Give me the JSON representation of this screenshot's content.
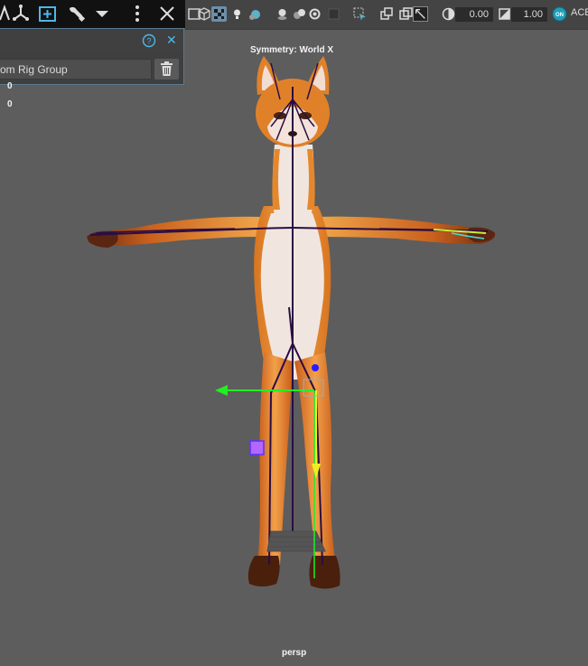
{
  "toolbar": {
    "left_icons": [
      "lasso-select-icon",
      "transform-axes-icon",
      "add-group-icon",
      "paint-brush-icon",
      "dropdown-arrow-icon",
      "more-options-icon",
      "close-icon"
    ],
    "viewport_icons": [
      "wireframe-icon",
      "cube-icon",
      "checker-icon",
      "light-icon",
      "shading-icon",
      "sphere-icon",
      "sphere-group-icon",
      "refresh-icon",
      "camera-gate-icon",
      "select-camera-icon",
      "layers-icon",
      "box-icon",
      "isolate-icon",
      "exposure-icon",
      "gamma-icon",
      "color-management-icon"
    ],
    "exposure_value": "0.00",
    "gamma_value": "1.00",
    "color_space_label": "ACE"
  },
  "panel": {
    "row_label": "om Rig Group",
    "help_label": "?",
    "close_label": "✕"
  },
  "hud": {
    "value_1": "0",
    "value_2": "0",
    "symmetry": "Symmetry: World X",
    "camera": "persp"
  },
  "colors": {
    "viewport_bg": "#5d5d5d",
    "fur_orange": "#e0832a",
    "fur_white": "#f1e4dc",
    "joint": "#2a0d44",
    "manip_x": "#22ee22",
    "manip_y": "#eeee22",
    "manip_pivot": "#2a1aff"
  }
}
